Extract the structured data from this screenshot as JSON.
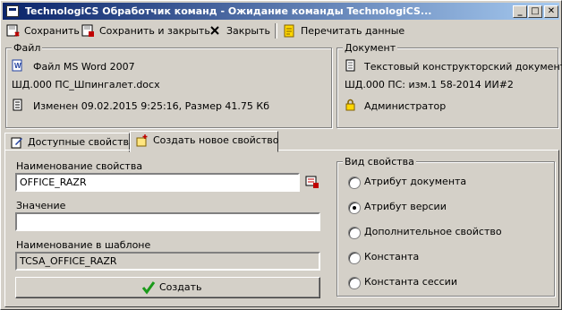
{
  "window": {
    "title": "TechnologiCS Обработчик команд  - Ожидание команды TechnologiCS...",
    "controls": {
      "minimize": "_",
      "maximize": "□",
      "close": "✕"
    }
  },
  "toolbar": {
    "save": "Сохранить",
    "save_close": "Сохранить и закрыть",
    "close": "Закрыть",
    "reread": "Перечитать данные"
  },
  "file_group": {
    "title": "Файл",
    "type": "Файл MS Word 2007",
    "name": "ШД.000 ПС_Шпингалет.docx",
    "modified": "Изменен 09.02.2015 9:25:16, Размер 41.75 Кб"
  },
  "doc_group": {
    "title": "Документ",
    "type": "Текстовый конструкторский документ",
    "name": "ШД.000 ПС: изм.1 58-2014 ИИ#2",
    "user": "Администратор"
  },
  "tabs": [
    {
      "label": "Доступные свойства",
      "icon": "edit-icon"
    },
    {
      "label": "Создать новое свойство",
      "icon": "new-property-icon"
    }
  ],
  "form": {
    "name_label": "Наименование свойства",
    "name_value": "OFFICE_RAZR",
    "value_label": "Значение",
    "value_value": "",
    "template_label": "Наименование в шаблоне",
    "template_value": "TCSA_OFFICE_RAZR",
    "create_label": "Создать"
  },
  "property_kind": {
    "title": "Вид свойства",
    "options": [
      {
        "label": "Атрибут документа",
        "selected": false
      },
      {
        "label": "Атрибут версии",
        "selected": true
      },
      {
        "label": "Дополнительное свойство",
        "selected": false
      },
      {
        "label": "Константа",
        "selected": false
      },
      {
        "label": "Константа сессии",
        "selected": false
      }
    ]
  },
  "colors": {
    "title_start": "#0a246a",
    "title_end": "#a6caf0",
    "face": "#d4d0c8",
    "ok_green": "#1a9a1a"
  }
}
